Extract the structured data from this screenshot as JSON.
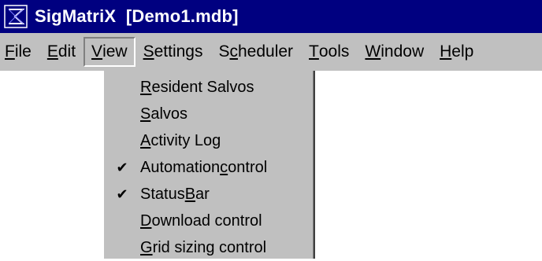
{
  "window": {
    "title": "SigMatriX  [Demo1.mdb]",
    "app_icon": "sigmatrix-logo-icon",
    "colors": {
      "titlebar": "#000080",
      "menubar": "#c0c0c0",
      "window": "#ffffff"
    }
  },
  "menubar": {
    "items": [
      {
        "label": "File",
        "pre": "",
        "key": "F",
        "post": "ile",
        "active": false
      },
      {
        "label": "Edit",
        "pre": "",
        "key": "E",
        "post": "dit",
        "active": false
      },
      {
        "label": "View",
        "pre": "",
        "key": "V",
        "post": "iew",
        "active": true
      },
      {
        "label": "Settings",
        "pre": "",
        "key": "S",
        "post": "ettings",
        "active": false
      },
      {
        "label": "Scheduler",
        "pre": "S",
        "key": "c",
        "post": "heduler",
        "active": false
      },
      {
        "label": "Tools",
        "pre": "",
        "key": "T",
        "post": "ools",
        "active": false
      },
      {
        "label": "Window",
        "pre": "",
        "key": "W",
        "post": "indow",
        "active": false
      },
      {
        "label": "Help",
        "pre": "",
        "key": "H",
        "post": "elp",
        "active": false
      }
    ]
  },
  "view_menu": {
    "items": [
      {
        "label": "Resident Salvos",
        "pre": "",
        "key": "R",
        "post": "esident Salvos",
        "checked": false
      },
      {
        "label": "Salvos",
        "pre": "",
        "key": "S",
        "post": "alvos",
        "checked": false
      },
      {
        "label": "Activity Log",
        "pre": "",
        "key": "A",
        "post": "ctivity Log",
        "checked": false
      },
      {
        "label": "Automation control",
        "pre": "Automation ",
        "key": "c",
        "post": "ontrol",
        "checked": true
      },
      {
        "label": "Status Bar",
        "pre": "Status ",
        "key": "B",
        "post": "ar",
        "checked": true
      },
      {
        "label": "Download control",
        "pre": "",
        "key": "D",
        "post": "ownload control",
        "checked": false
      },
      {
        "label": "Grid sizing control",
        "pre": "",
        "key": "G",
        "post": "rid sizing control",
        "checked": false
      }
    ],
    "check_glyph": "✔"
  }
}
